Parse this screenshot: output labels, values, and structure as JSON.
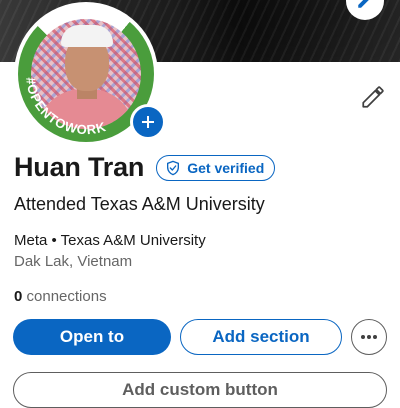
{
  "cover": {
    "edit_icon": "pencil-icon"
  },
  "avatar": {
    "badge_text": "#OPENTOWORK",
    "add_icon": "plus-icon",
    "ring_color": "#4a9d3c"
  },
  "profile_edit_icon": "pencil-icon",
  "profile": {
    "name": "Huan Tran",
    "verify_label": "Get verified",
    "verify_icon": "shield-check-icon",
    "headline": "Attended Texas A&M University",
    "meta": "Meta • Texas A&M University",
    "location": "Dak Lak, Vietnam",
    "connections_count": "0",
    "connections_label": "connections"
  },
  "actions": {
    "open_to": "Open to",
    "add_section": "Add section",
    "more_icon": "more-horizontal-icon",
    "add_custom": "Add custom button"
  },
  "colors": {
    "brand_blue": "#0a66c2",
    "text_primary": "#191919",
    "text_secondary": "#666666",
    "open_to_work_green": "#4a9d3c"
  }
}
